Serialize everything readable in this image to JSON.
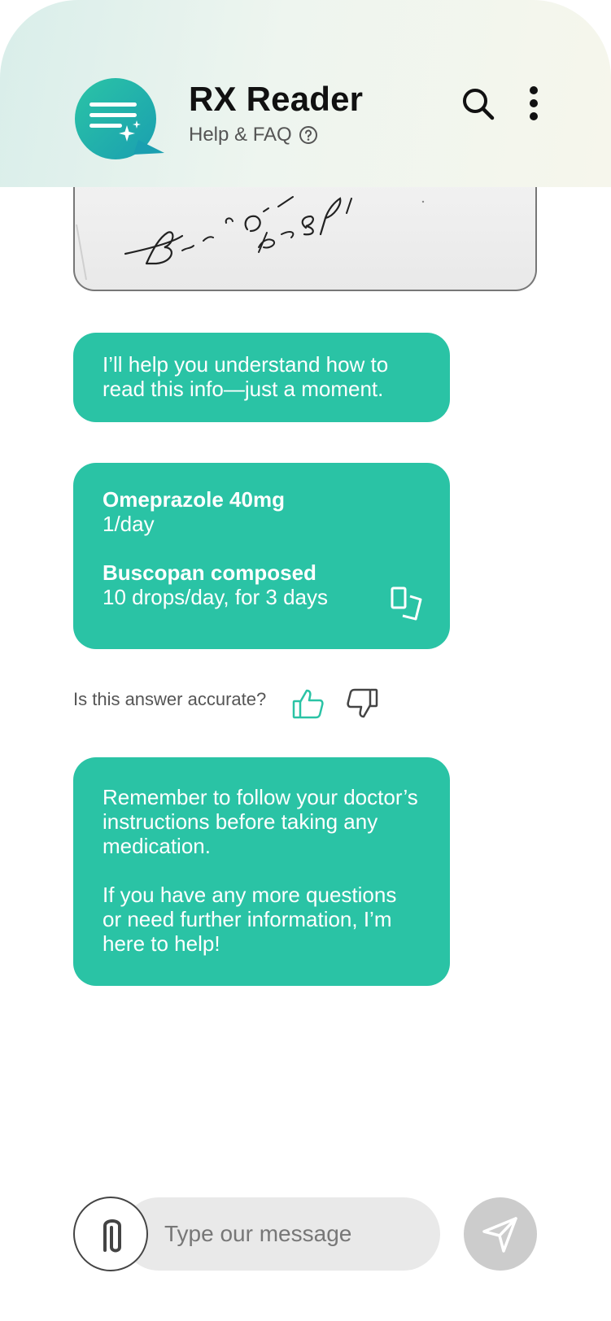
{
  "header": {
    "title": "RX Reader",
    "subtitle": "Help & FAQ",
    "help_icon": "question-circle-icon",
    "search_icon": "search-icon",
    "menu_icon": "more-vertical-icon",
    "logo_icon": "chat-sparkle-logo"
  },
  "prescription_image": {
    "kind": "handwritten-prescription-photo"
  },
  "messages": {
    "intro": "I’ll help you understand how to read this info—just a moment.",
    "medications": [
      {
        "name": "Omeprazole 40mg",
        "dosage": "1/day"
      },
      {
        "name": "Buscopan composed",
        "dosage": "10 drops/day, for 3 days"
      }
    ],
    "copy_icon": "copy-icon",
    "closing_1": "Remember to follow your doctor’s instructions before taking any medication.",
    "closing_2": "If you have any more questions or need further information, I’m here to help!"
  },
  "feedback": {
    "question": "Is this answer accurate?",
    "thumbs_up_icon": "thumbs-up-icon",
    "thumbs_down_icon": "thumbs-down-icon"
  },
  "composer": {
    "placeholder": "Type our message",
    "value": "",
    "attach_icon": "paperclip-icon",
    "send_icon": "send-icon"
  },
  "colors": {
    "accent": "#2ac3a5",
    "logo_gradient_start": "#2bc4a6",
    "logo_gradient_end": "#1a9fb0",
    "send_button_disabled": "#cccccc",
    "input_background": "#e9e9e9"
  }
}
